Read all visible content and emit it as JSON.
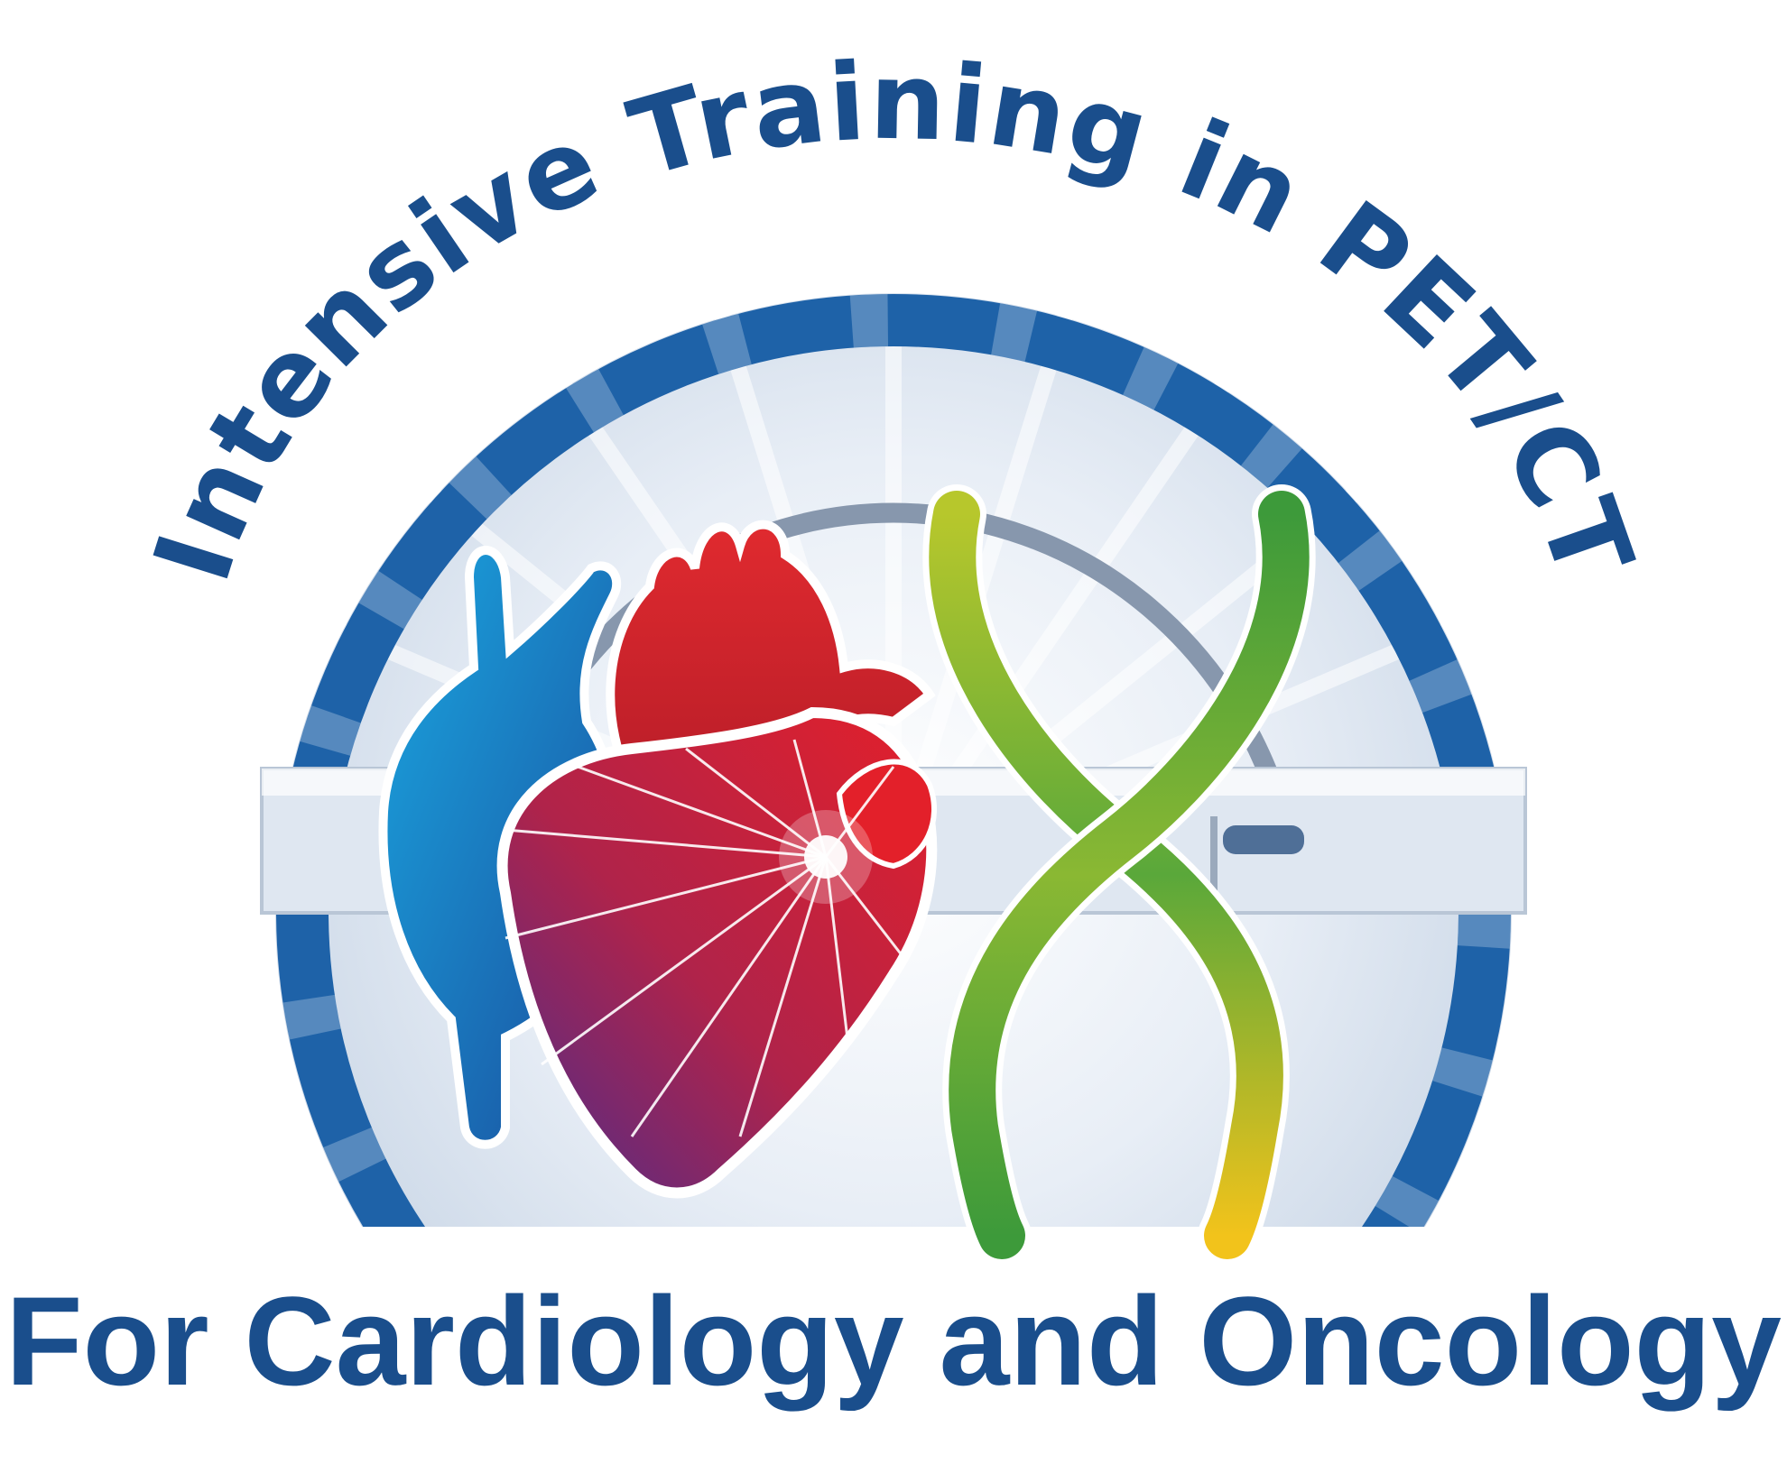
{
  "logo": {
    "arc_title": "Intensive Training in PET/CT",
    "subtitle": "For Cardiology and Oncology"
  },
  "colors": {
    "text_blue": "#1a4e8c",
    "ring_blue": "#1e62a8",
    "heart_red": "#d8222e",
    "vessel_blue": "#1383c7",
    "dna_green": "#3f9e3a",
    "dna_yellow": "#f2c31b"
  },
  "icons": [
    "pet-ct-scanner-icon",
    "heart-icon",
    "dna-helix-icon"
  ]
}
